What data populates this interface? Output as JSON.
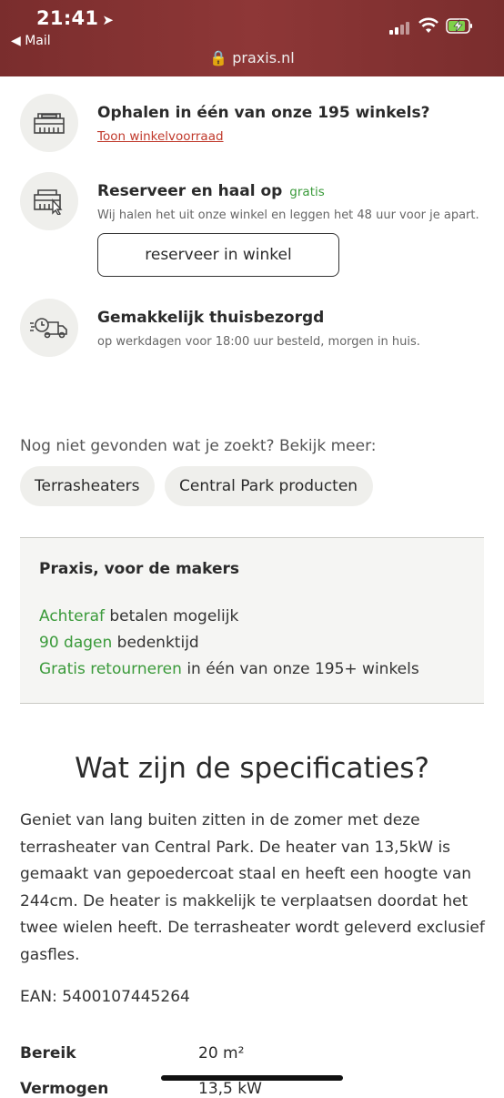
{
  "status": {
    "time": "21:41",
    "back_app": "Mail",
    "url": "praxis.nl"
  },
  "options": [
    {
      "icon": "store-icon",
      "title": "Ophalen in één van onze 195 winkels?",
      "link": "Toon winkelvoorraad"
    },
    {
      "icon": "reserve-store-icon",
      "title": "Reserveer en haal op",
      "badge": "gratis",
      "sub": "Wij halen het uit onze winkel en leggen het 48 uur voor je apart.",
      "button": "reserveer in winkel"
    },
    {
      "icon": "delivery-truck-icon",
      "title": "Gemakkelijk thuisbezorgd",
      "sub": "op werkdagen voor 18:00 uur besteld, morgen in huis."
    }
  ],
  "more": {
    "text": "Nog niet gevonden wat je zoekt? Bekijk meer:",
    "chips": [
      "Terrasheaters",
      "Central Park producten"
    ]
  },
  "usp": {
    "title": "Praxis, voor de makers",
    "rows": [
      {
        "hl": "Achteraf",
        "rest": " betalen mogelijk"
      },
      {
        "hl": "90 dagen",
        "rest": " bedenktijd"
      },
      {
        "hl": "Gratis retourneren",
        "rest": " in één van onze 195+ winkels"
      }
    ]
  },
  "specs": {
    "title": "Wat zijn de specificaties?",
    "description": "Geniet van lang buiten zitten in de zomer met deze terrasheater van Central Park. De heater van 13,5kW is gemaakt van gepoedercoat staal en heeft een hoogte van 244cm. De heater is makkelijk te verplaatsen doordat het twee wielen heeft. De terrasheater wordt geleverd exclusief gasfles.",
    "ean": "EAN: 5400107445264",
    "table": [
      {
        "label": "Bereik",
        "value": "20 m²"
      },
      {
        "label": "Vermogen",
        "value": "13,5 kW"
      }
    ]
  },
  "colors": {
    "accent_green": "#3a9a3a",
    "link_red": "#c0392b",
    "statusbar": "#8e3737"
  }
}
